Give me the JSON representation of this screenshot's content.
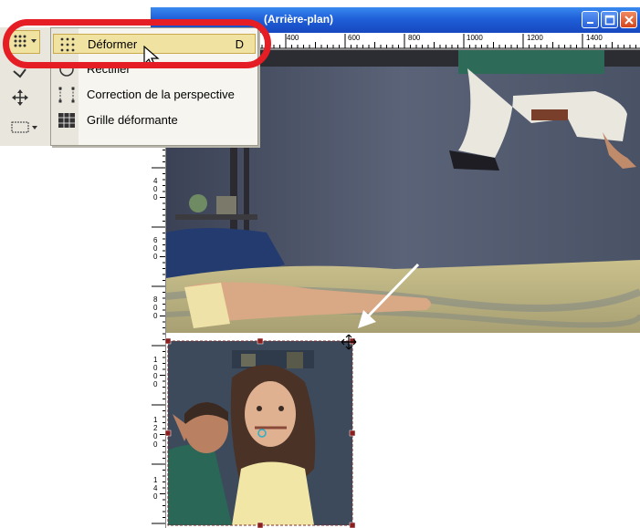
{
  "window": {
    "title": "(Arrière-plan)",
    "buttons": [
      "minimize",
      "maximize",
      "close"
    ]
  },
  "ruler": {
    "top_labels": [
      "400",
      "600",
      "800",
      "1000",
      "1200",
      "1400"
    ],
    "left_labels": [
      "4",
      "0",
      "0",
      "6",
      "0",
      "0",
      "8",
      "0",
      "0",
      "1",
      "0",
      "0",
      "0",
      "1",
      "2",
      "0",
      "0",
      "1",
      "4",
      "0"
    ]
  },
  "toolbox": {
    "tools": [
      "deform-tool",
      "straighten-tool",
      "move-tool",
      "selection-tool"
    ]
  },
  "menu": {
    "items": [
      {
        "label": "Déformer",
        "shortcut": "D",
        "icon": "deform-icon",
        "highlighted": true
      },
      {
        "label": "Rectifier",
        "shortcut": "",
        "icon": "straighten-icon",
        "highlighted": false
      },
      {
        "label": "Correction de la perspective",
        "shortcut": "",
        "icon": "perspective-icon",
        "highlighted": false
      },
      {
        "label": "Grille déformante",
        "shortcut": "",
        "icon": "mesh-warp-icon",
        "highlighted": false
      }
    ]
  },
  "colors": {
    "title_bar": "#1f5fd8",
    "highlight": "#e51d25",
    "menu_hover": "#f0e3a2"
  }
}
